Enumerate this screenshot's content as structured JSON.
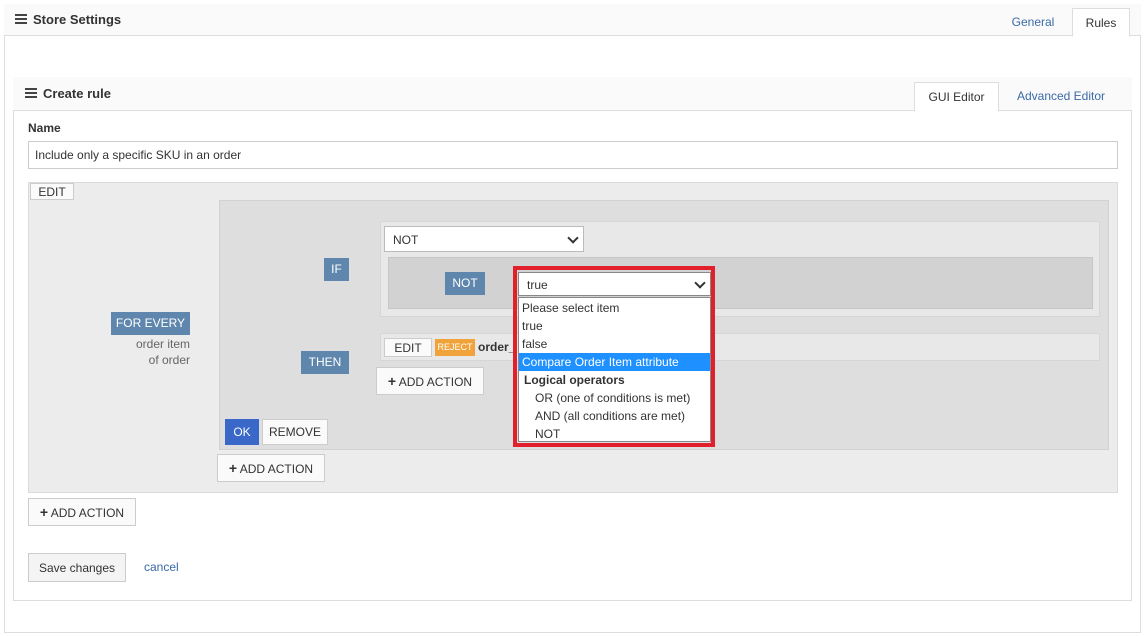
{
  "store": {
    "title": "Store Settings",
    "tabs": [
      "General",
      "Rules"
    ]
  },
  "rule": {
    "title": "Create rule",
    "tabs": [
      "GUI Editor",
      "Advanced Editor"
    ],
    "name_label": "Name",
    "name_value": "Include only a specific SKU in an order",
    "edit_label": "EDIT",
    "for_every": "FOR EVERY",
    "for_every_sub1": "order item",
    "for_every_sub2": "of order",
    "if_label": "IF",
    "then_label": "THEN",
    "top_select_value": "NOT",
    "not_label": "NOT",
    "condition_select_value": "true",
    "action_edit": "EDIT",
    "reject_tag": "REJECT",
    "action_text": "order_",
    "add_action": "ADD ACTION",
    "ok": "OK",
    "remove": "REMOVE",
    "save": "Save changes",
    "cancel": "cancel"
  },
  "dropdown": {
    "items": [
      {
        "label": "Please select item",
        "kind": "option"
      },
      {
        "label": "true",
        "kind": "option"
      },
      {
        "label": "false",
        "kind": "option"
      },
      {
        "label": "Compare Order Item attribute",
        "kind": "selected"
      },
      {
        "label": "Logical operators",
        "kind": "group"
      },
      {
        "label": "OR (one of conditions is met)",
        "kind": "sub"
      },
      {
        "label": "AND (all conditions are met)",
        "kind": "sub"
      },
      {
        "label": "NOT",
        "kind": "sub"
      }
    ],
    "highlight_color": "#e2202c"
  },
  "colors": {
    "badge": "#5f86ad",
    "ok": "#3a68c8",
    "reject": "#f0a33a",
    "selection": "#1e90ff"
  }
}
